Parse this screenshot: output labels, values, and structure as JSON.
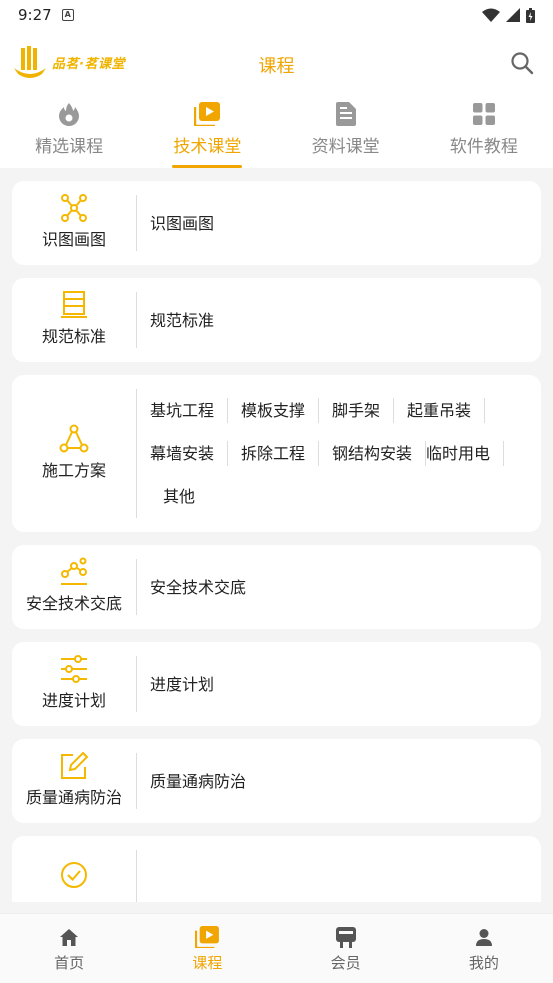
{
  "status": {
    "time": "9:27",
    "a_badge": "A"
  },
  "header": {
    "logo_text": "品茗·茗课堂",
    "title": "课程"
  },
  "tabs": [
    {
      "label": "精选课程",
      "icon": "flame-icon",
      "active": false
    },
    {
      "label": "技术课堂",
      "icon": "video-icon",
      "active": true
    },
    {
      "label": "资料课堂",
      "icon": "document-icon",
      "active": false
    },
    {
      "label": "软件教程",
      "icon": "grid-icon",
      "active": false
    }
  ],
  "categories": [
    {
      "label": "识图画图",
      "icon": "network-icon",
      "items": [
        "识图画图"
      ]
    },
    {
      "label": "规范标准",
      "icon": "list-doc-icon",
      "items": [
        "规范标准"
      ]
    },
    {
      "label": "施工方案",
      "icon": "triangle-nodes-icon",
      "items": [
        "基坑工程",
        "模板支撑",
        "脚手架",
        "起重吊装",
        "幕墙安装",
        "拆除工程",
        "钢结构安装",
        "临时用电",
        "其他"
      ]
    },
    {
      "label": "安全技术交底",
      "icon": "route-icon",
      "items": [
        "安全技术交底"
      ]
    },
    {
      "label": "进度计划",
      "icon": "sliders-icon",
      "items": [
        "进度计划"
      ]
    },
    {
      "label": "质量通病防治",
      "icon": "edit-icon",
      "items": [
        "质量通病防治"
      ]
    }
  ],
  "bottom_nav": [
    {
      "label": "首页",
      "icon": "home-icon",
      "active": false
    },
    {
      "label": "课程",
      "icon": "course-icon",
      "active": true
    },
    {
      "label": "会员",
      "icon": "member-icon",
      "active": false
    },
    {
      "label": "我的",
      "icon": "person-icon",
      "active": false
    }
  ],
  "colors": {
    "accent": "#f0a500",
    "accent_light": "#f5b800",
    "background": "#f4f4f4"
  }
}
